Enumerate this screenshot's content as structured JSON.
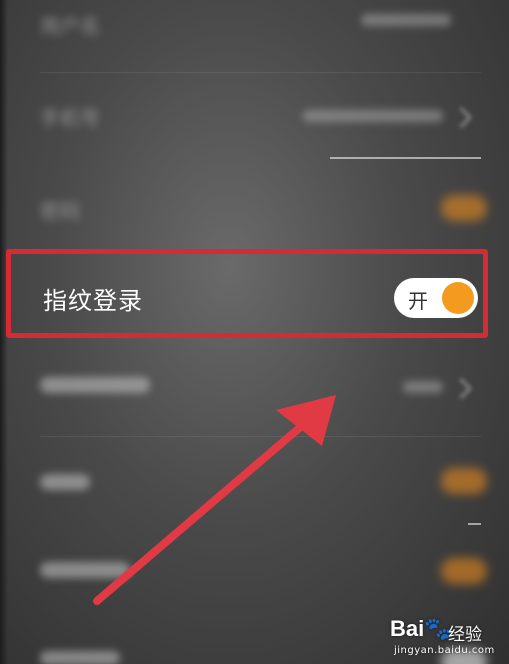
{
  "settings": {
    "fingerprint_login": {
      "label": "指纹登录",
      "toggle_text": "开",
      "state": "on"
    },
    "blurred_rows": [
      {
        "label": "用户名",
        "value": "",
        "control": "text"
      },
      {
        "label": "手机号",
        "value": "",
        "control": "chevron"
      },
      {
        "label": "密码",
        "value": "",
        "control": "toggle"
      },
      {
        "label": "",
        "value": "",
        "control": "chevron"
      },
      {
        "label": "",
        "value": "",
        "control": "toggle"
      },
      {
        "label": "",
        "value": "",
        "control": "toggle"
      }
    ]
  },
  "colors": {
    "highlight_box": "#d82a35",
    "toggle_on": "#f39a1f",
    "arrow": "#e23a45"
  },
  "watermark": {
    "brand": "Bai",
    "brand_suffix": "经验",
    "url": "jingyan.baidu.com"
  }
}
